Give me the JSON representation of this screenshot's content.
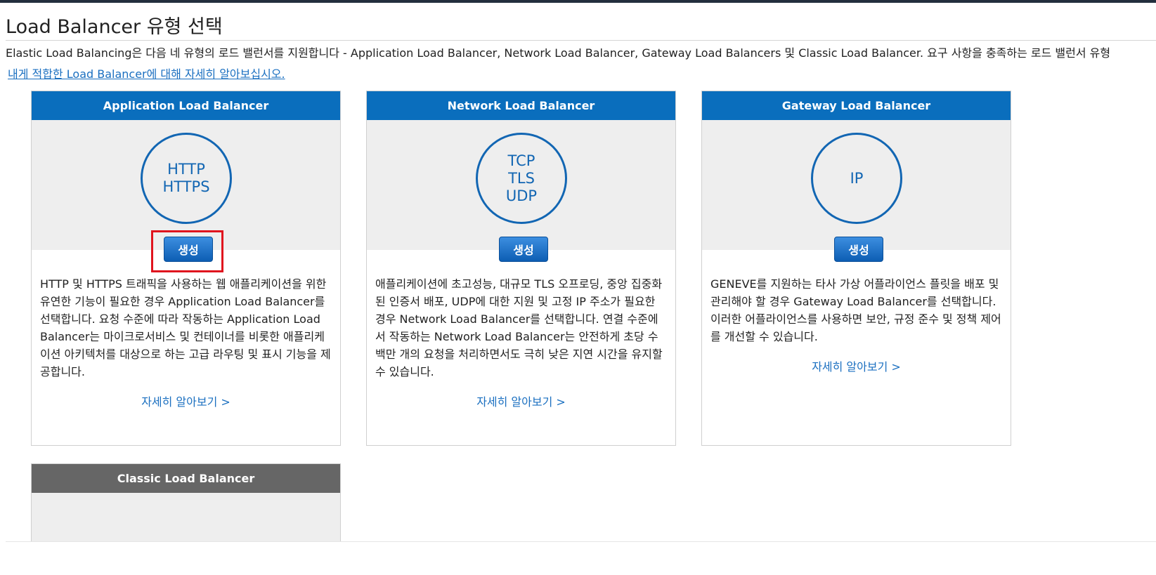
{
  "page": {
    "title": "Load Balancer 유형 선택",
    "intro": "Elastic Load Balancing은 다음 네 유형의 로드 밸런서를 지원합니다 - Application Load Balancer, Network Load Balancer, Gateway Load Balancers 및 Classic Load Balancer. 요구 사항을 충족하는 로드 밸런서 유형",
    "intro_link": "내게 적합한 Load Balancer에 대해 자세히 알아보십시오."
  },
  "colors": {
    "header_blue": "#0a6ebd",
    "header_gray": "#666666",
    "protocol_blue": "#1266b3",
    "highlight_red": "#e0141e"
  },
  "cards": [
    {
      "title": "Application Load Balancer",
      "protocols": [
        "HTTP",
        "HTTPS"
      ],
      "create_label": "생성",
      "description": "HTTP 및 HTTPS 트래픽을 사용하는 웹 애플리케이션을 위한 유연한 기능이 필요한 경우 Application Load Balancer를 선택합니다. 요청 수준에 따라 작동하는 Application Load Balancer는 마이크로서비스 및 컨테이너를 비롯한 애플리케이션 아키텍처를 대상으로 하는 고급 라우팅 및 표시 기능을 제공합니다.",
      "learn_more": "자세히 알아보기 >",
      "highlighted": true
    },
    {
      "title": "Network Load Balancer",
      "protocols": [
        "TCP",
        "TLS",
        "UDP"
      ],
      "create_label": "생성",
      "description": "애플리케이션에 초고성능, 대규모 TLS 오프로딩, 중앙 집중화된 인증서 배포, UDP에 대한 지원 및 고정 IP 주소가 필요한 경우 Network Load Balancer를 선택합니다. 연결 수준에서 작동하는 Network Load Balancer는 안전하게 초당 수백만 개의 요청을 처리하면서도 극히 낮은 지연 시간을 유지할 수 있습니다.",
      "learn_more": "자세히 알아보기 >"
    },
    {
      "title": "Gateway Load Balancer",
      "protocols": [
        "IP"
      ],
      "create_label": "생성",
      "description": "GENEVE를 지원하는 타사 가상 어플라이언스 플릿을 배포 및 관리해야 할 경우 Gateway Load Balancer를 선택합니다. 이러한 어플라이언스를 사용하면 보안, 규정 준수 및 정책 제어를 개선할 수 있습니다.",
      "learn_more": "자세히 알아보기 >"
    },
    {
      "title": "Classic Load Balancer"
    }
  ]
}
